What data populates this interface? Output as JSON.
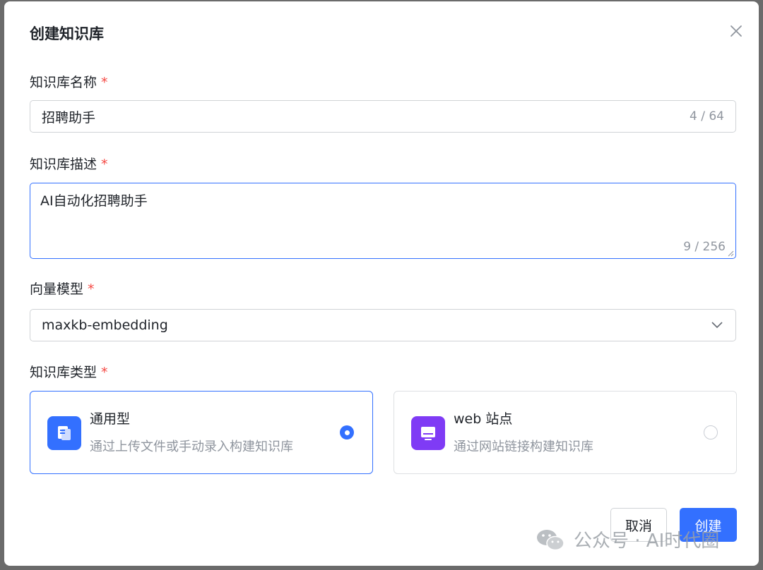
{
  "dialog": {
    "title": "创建知识库",
    "close_icon": "close-icon"
  },
  "form": {
    "name": {
      "label": "知识库名称",
      "required_mark": "*",
      "value": "招聘助手",
      "count": "4 / 64"
    },
    "description": {
      "label": "知识库描述",
      "required_mark": "*",
      "value": "AI自动化招聘助手",
      "count": "9 / 256"
    },
    "model": {
      "label": "向量模型",
      "required_mark": "*",
      "value": "maxkb-embedding",
      "icon": "chevron-down-icon"
    },
    "type": {
      "label": "知识库类型",
      "required_mark": "*",
      "options": [
        {
          "title": "通用型",
          "desc": "通过上传文件或手动录入构建知识库",
          "icon": "document-icon",
          "icon_color": "#3370ff",
          "selected": true
        },
        {
          "title": "web 站点",
          "desc": "通过网站链接构建知识库",
          "icon": "monitor-icon",
          "icon_color": "#7f3bf5",
          "selected": false
        }
      ]
    }
  },
  "footer": {
    "cancel_label": "取消",
    "create_label": "创建"
  },
  "watermark": {
    "text": "公众号 · AI时代圈",
    "icon": "wechat-icon"
  },
  "colors": {
    "accent": "#3370ff",
    "required": "#f54a45",
    "web_icon": "#7f3bf5"
  }
}
